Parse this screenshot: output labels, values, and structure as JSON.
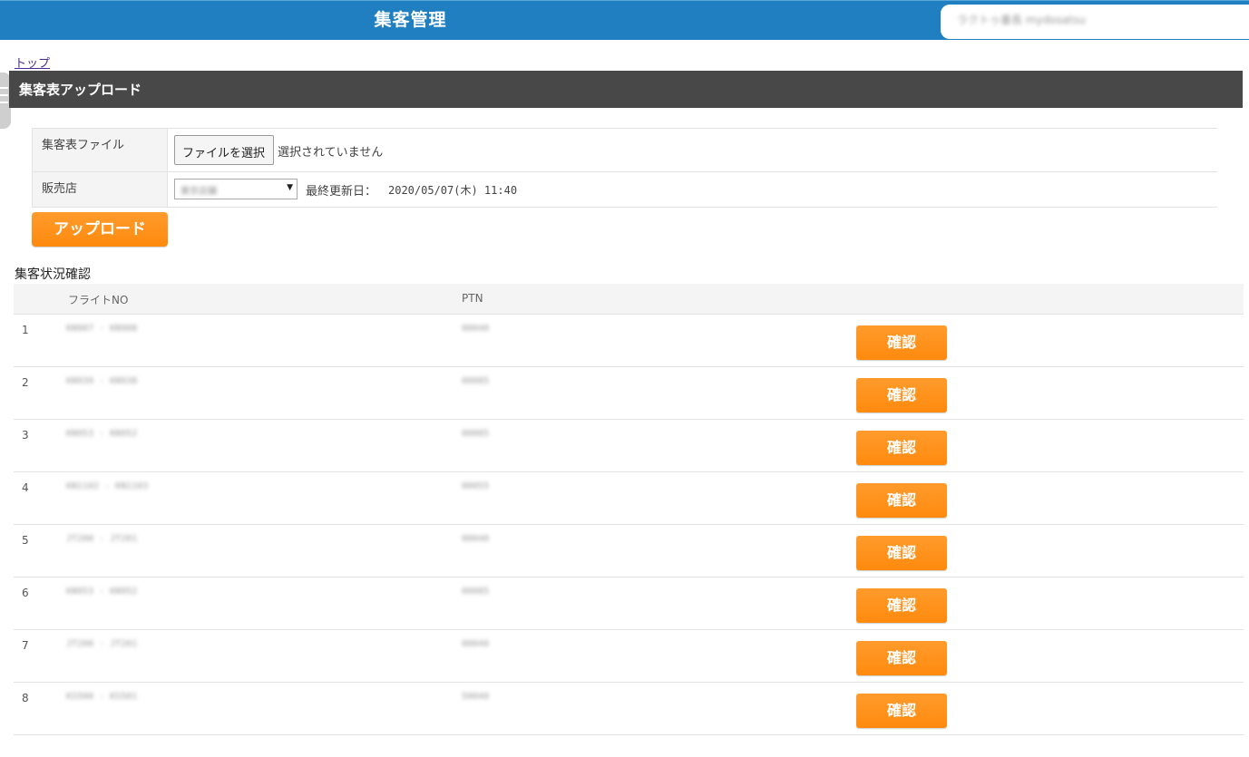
{
  "header": {
    "title": "集客管理",
    "user": "ラクトゥ番長 mydosatsu"
  },
  "breadcrumb": {
    "top": "トップ"
  },
  "section": {
    "title": "集客表アップロード"
  },
  "form": {
    "file_label": "集客表ファイル",
    "file_button": "ファイルを選択",
    "file_status": "選択されていません",
    "store_label": "販売店",
    "store_value": "東京店舗",
    "updated_label": "最終更新日：",
    "updated_value": "2020/05/07(木) 11:40"
  },
  "upload_button": "アップロード",
  "list": {
    "title": "集客状況確認",
    "headers": {
      "flight": "フライトNO",
      "ptn": "PTN"
    },
    "confirm_label": "確認",
    "rows": [
      {
        "num": "1",
        "flight": "KN907 - KN908",
        "ptn": "00040"
      },
      {
        "num": "2",
        "flight": "KN939 - KN938",
        "ptn": "00085"
      },
      {
        "num": "3",
        "flight": "KN953 - KN952",
        "ptn": "00085"
      },
      {
        "num": "4",
        "flight": "KN1102 - KN1103",
        "ptn": "00055"
      },
      {
        "num": "5",
        "flight": "JT200 - JT201",
        "ptn": "00040"
      },
      {
        "num": "6",
        "flight": "KN953 - KN952",
        "ptn": "00085"
      },
      {
        "num": "7",
        "flight": "JT200 - JT201",
        "ptn": "00040"
      },
      {
        "num": "8",
        "flight": "KS500 - KS501",
        "ptn": "50040"
      }
    ]
  }
}
